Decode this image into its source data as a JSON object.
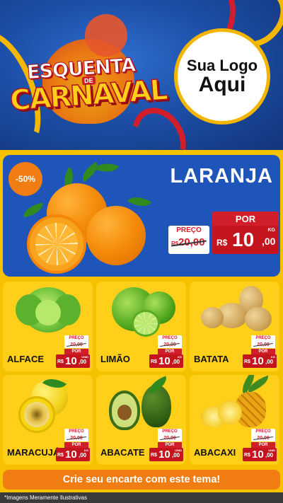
{
  "header": {
    "title_line1": "ESQUENTA",
    "title_de": "DE",
    "title_line2": "CARNAVAL",
    "logo_line1": "Sua Logo",
    "logo_line2": "Aqui"
  },
  "featured": {
    "discount": "-50%",
    "name": "LARANJA",
    "old_label": "PREÇO",
    "old_currency": "R$",
    "old_price": "20,00",
    "por_label": "POR",
    "currency": "R$",
    "price_int": "10",
    "price_dec": ",00",
    "unit": "KG"
  },
  "products": [
    {
      "name": "ALFACE",
      "old_label": "PREÇO",
      "old_price": "20,00",
      "por_label": "POR",
      "currency": "R$",
      "price_int": "10",
      "price_dec": ",00",
      "unit": "UNID"
    },
    {
      "name": "LIMÃO",
      "old_label": "PREÇO",
      "old_price": "20,00",
      "por_label": "POR",
      "currency": "R$",
      "price_int": "10",
      "price_dec": ",00",
      "unit": "KG"
    },
    {
      "name": "BATATA",
      "old_label": "PREÇO",
      "old_price": "20,00",
      "por_label": "POR",
      "currency": "R$",
      "price_int": "10",
      "price_dec": ",00",
      "unit": "KG"
    },
    {
      "name": "MARACUJÁ",
      "old_label": "PREÇO",
      "old_price": "20,00",
      "por_label": "POR",
      "currency": "R$",
      "price_int": "10",
      "price_dec": ",00",
      "unit": "KG"
    },
    {
      "name": "ABACATE",
      "old_label": "PREÇO",
      "old_price": "20,00",
      "por_label": "POR",
      "currency": "R$",
      "price_int": "10",
      "price_dec": ",00",
      "unit": "UNID"
    },
    {
      "name": "ABACAXI",
      "old_label": "PREÇO",
      "old_price": "20,00",
      "por_label": "POR",
      "currency": "R$",
      "price_int": "10",
      "price_dec": ",00",
      "unit": "UNID"
    }
  ],
  "cta": "Crie seu encarte com este tema!",
  "disclaimer": "*Imagens Meramente Ilustrativas",
  "colors": {
    "background": "#f6c200",
    "featured_bg": "#1f55b8",
    "price_red": "#c4151f",
    "cta_orange": "#f07c12"
  },
  "icons": [
    "orange-fruit",
    "lettuce",
    "lime",
    "potato",
    "passion-fruit",
    "avocado",
    "pineapple"
  ]
}
